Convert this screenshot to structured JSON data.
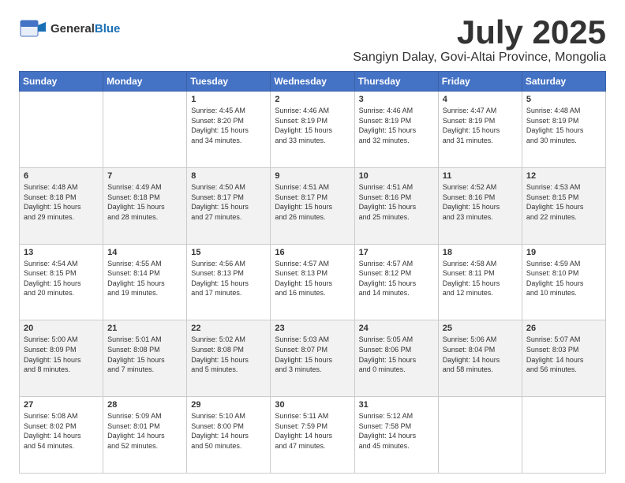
{
  "header": {
    "logo_line1": "General",
    "logo_line2": "Blue",
    "month": "July 2025",
    "location": "Sangiyn Dalay, Govi-Altai Province, Mongolia"
  },
  "days_of_week": [
    "Sunday",
    "Monday",
    "Tuesday",
    "Wednesday",
    "Thursday",
    "Friday",
    "Saturday"
  ],
  "weeks": [
    [
      {
        "day": "",
        "info": ""
      },
      {
        "day": "",
        "info": ""
      },
      {
        "day": "1",
        "info": "Sunrise: 4:45 AM\nSunset: 8:20 PM\nDaylight: 15 hours\nand 34 minutes."
      },
      {
        "day": "2",
        "info": "Sunrise: 4:46 AM\nSunset: 8:19 PM\nDaylight: 15 hours\nand 33 minutes."
      },
      {
        "day": "3",
        "info": "Sunrise: 4:46 AM\nSunset: 8:19 PM\nDaylight: 15 hours\nand 32 minutes."
      },
      {
        "day": "4",
        "info": "Sunrise: 4:47 AM\nSunset: 8:19 PM\nDaylight: 15 hours\nand 31 minutes."
      },
      {
        "day": "5",
        "info": "Sunrise: 4:48 AM\nSunset: 8:19 PM\nDaylight: 15 hours\nand 30 minutes."
      }
    ],
    [
      {
        "day": "6",
        "info": "Sunrise: 4:48 AM\nSunset: 8:18 PM\nDaylight: 15 hours\nand 29 minutes."
      },
      {
        "day": "7",
        "info": "Sunrise: 4:49 AM\nSunset: 8:18 PM\nDaylight: 15 hours\nand 28 minutes."
      },
      {
        "day": "8",
        "info": "Sunrise: 4:50 AM\nSunset: 8:17 PM\nDaylight: 15 hours\nand 27 minutes."
      },
      {
        "day": "9",
        "info": "Sunrise: 4:51 AM\nSunset: 8:17 PM\nDaylight: 15 hours\nand 26 minutes."
      },
      {
        "day": "10",
        "info": "Sunrise: 4:51 AM\nSunset: 8:16 PM\nDaylight: 15 hours\nand 25 minutes."
      },
      {
        "day": "11",
        "info": "Sunrise: 4:52 AM\nSunset: 8:16 PM\nDaylight: 15 hours\nand 23 minutes."
      },
      {
        "day": "12",
        "info": "Sunrise: 4:53 AM\nSunset: 8:15 PM\nDaylight: 15 hours\nand 22 minutes."
      }
    ],
    [
      {
        "day": "13",
        "info": "Sunrise: 4:54 AM\nSunset: 8:15 PM\nDaylight: 15 hours\nand 20 minutes."
      },
      {
        "day": "14",
        "info": "Sunrise: 4:55 AM\nSunset: 8:14 PM\nDaylight: 15 hours\nand 19 minutes."
      },
      {
        "day": "15",
        "info": "Sunrise: 4:56 AM\nSunset: 8:13 PM\nDaylight: 15 hours\nand 17 minutes."
      },
      {
        "day": "16",
        "info": "Sunrise: 4:57 AM\nSunset: 8:13 PM\nDaylight: 15 hours\nand 16 minutes."
      },
      {
        "day": "17",
        "info": "Sunrise: 4:57 AM\nSunset: 8:12 PM\nDaylight: 15 hours\nand 14 minutes."
      },
      {
        "day": "18",
        "info": "Sunrise: 4:58 AM\nSunset: 8:11 PM\nDaylight: 15 hours\nand 12 minutes."
      },
      {
        "day": "19",
        "info": "Sunrise: 4:59 AM\nSunset: 8:10 PM\nDaylight: 15 hours\nand 10 minutes."
      }
    ],
    [
      {
        "day": "20",
        "info": "Sunrise: 5:00 AM\nSunset: 8:09 PM\nDaylight: 15 hours\nand 8 minutes."
      },
      {
        "day": "21",
        "info": "Sunrise: 5:01 AM\nSunset: 8:08 PM\nDaylight: 15 hours\nand 7 minutes."
      },
      {
        "day": "22",
        "info": "Sunrise: 5:02 AM\nSunset: 8:08 PM\nDaylight: 15 hours\nand 5 minutes."
      },
      {
        "day": "23",
        "info": "Sunrise: 5:03 AM\nSunset: 8:07 PM\nDaylight: 15 hours\nand 3 minutes."
      },
      {
        "day": "24",
        "info": "Sunrise: 5:05 AM\nSunset: 8:06 PM\nDaylight: 15 hours\nand 0 minutes."
      },
      {
        "day": "25",
        "info": "Sunrise: 5:06 AM\nSunset: 8:04 PM\nDaylight: 14 hours\nand 58 minutes."
      },
      {
        "day": "26",
        "info": "Sunrise: 5:07 AM\nSunset: 8:03 PM\nDaylight: 14 hours\nand 56 minutes."
      }
    ],
    [
      {
        "day": "27",
        "info": "Sunrise: 5:08 AM\nSunset: 8:02 PM\nDaylight: 14 hours\nand 54 minutes."
      },
      {
        "day": "28",
        "info": "Sunrise: 5:09 AM\nSunset: 8:01 PM\nDaylight: 14 hours\nand 52 minutes."
      },
      {
        "day": "29",
        "info": "Sunrise: 5:10 AM\nSunset: 8:00 PM\nDaylight: 14 hours\nand 50 minutes."
      },
      {
        "day": "30",
        "info": "Sunrise: 5:11 AM\nSunset: 7:59 PM\nDaylight: 14 hours\nand 47 minutes."
      },
      {
        "day": "31",
        "info": "Sunrise: 5:12 AM\nSunset: 7:58 PM\nDaylight: 14 hours\nand 45 minutes."
      },
      {
        "day": "",
        "info": ""
      },
      {
        "day": "",
        "info": ""
      }
    ]
  ]
}
